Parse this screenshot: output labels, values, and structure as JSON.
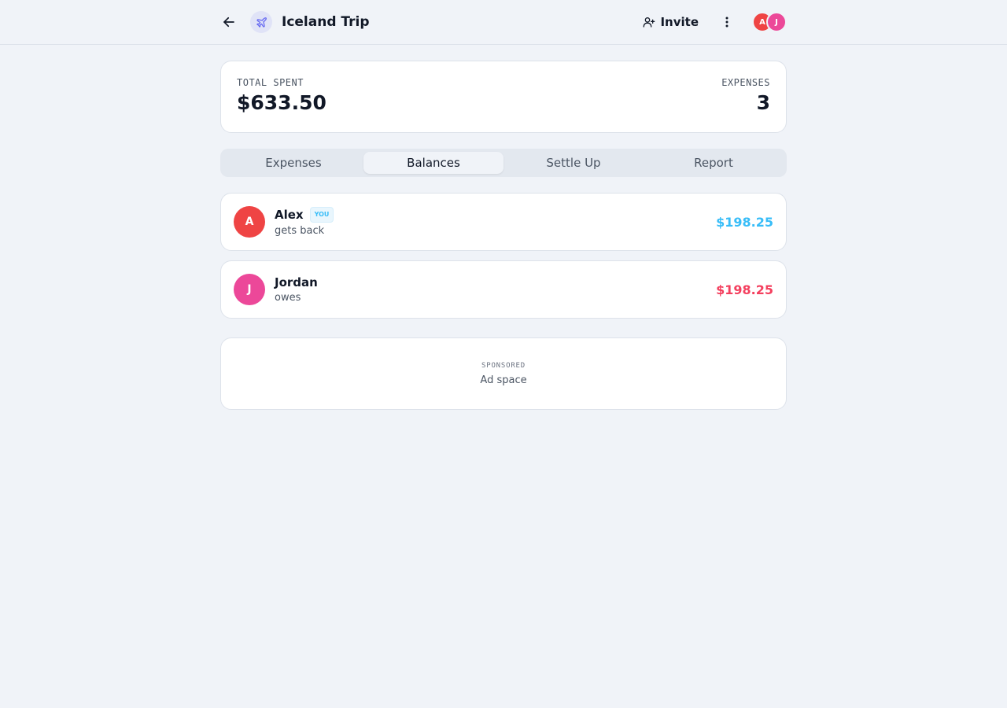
{
  "header": {
    "title": "Iceland Trip",
    "trip_icon": "plane-icon",
    "invite_label": "Invite",
    "members": [
      {
        "initial": "A",
        "color": "#ef4444"
      },
      {
        "initial": "J",
        "color": "#ec4899"
      }
    ]
  },
  "summary": {
    "total_label": "TOTAL SPENT",
    "total_value": "$633.50",
    "expenses_label": "EXPENSES",
    "expenses_value": "3"
  },
  "tabs": [
    {
      "label": "Expenses",
      "active": false
    },
    {
      "label": "Balances",
      "active": true
    },
    {
      "label": "Settle Up",
      "active": false
    },
    {
      "label": "Report",
      "active": false
    }
  ],
  "balances": [
    {
      "initial": "A",
      "name": "Alex",
      "badge": "YOU",
      "status": "gets back",
      "amount": "$198.25",
      "avatar_color": "#ef4444",
      "amount_color": "#38bdf8"
    },
    {
      "initial": "J",
      "name": "Jordan",
      "badge": "",
      "status": "owes",
      "amount": "$198.25",
      "avatar_color": "#ec4899",
      "amount_color": "#f43f5e"
    }
  ],
  "ad": {
    "label": "SPONSORED",
    "text": "Ad space"
  },
  "colors": {
    "accent": "#6366f1",
    "positive": "#38bdf8",
    "negative": "#f43f5e"
  }
}
